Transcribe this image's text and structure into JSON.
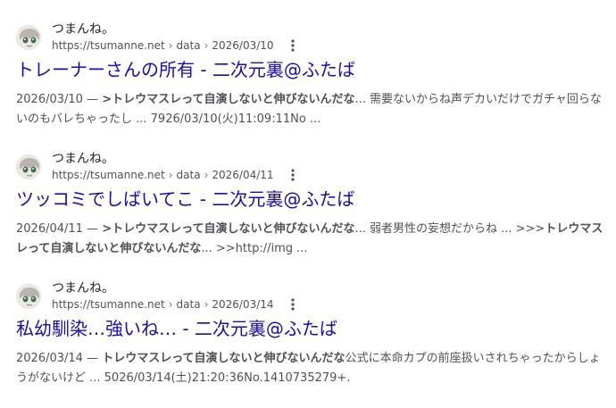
{
  "results": [
    {
      "site_name": "つまんね。",
      "url_base": "https://tsumanne.net",
      "url_crumbs": [
        "data",
        "2026/03/10"
      ],
      "title": "トレーナーさんの所有 - 二次元裏@ふたば",
      "snippet_parts": [
        {
          "text": "2026/03/10 — ",
          "bold": false
        },
        {
          "text": ">トレウマスレって自演しないと伸びないんだな",
          "bold": true
        },
        {
          "text": "... 需要ないからね声デカいだけでガチャ回らないのもバレちゃったし ... 7926/03/10(火)11:09:11No ...",
          "bold": false
        }
      ]
    },
    {
      "site_name": "つまんね。",
      "url_base": "https://tsumanne.net",
      "url_crumbs": [
        "data",
        "2026/04/11"
      ],
      "title": "ツッコミでしばいてこ - 二次元裏@ふたば",
      "snippet_parts": [
        {
          "text": "2026/04/11 — ",
          "bold": false
        },
        {
          "text": ">トレウマスレって自演しないと伸びないんだな",
          "bold": true
        },
        {
          "text": "... 弱者男性の妄想だからね ... >>>",
          "bold": false
        },
        {
          "text": "トレウマスレって自演しないと伸びないんだな",
          "bold": true
        },
        {
          "text": "... >>http://img ...",
          "bold": false
        }
      ]
    },
    {
      "site_name": "つまんね。",
      "url_base": "https://tsumanne.net",
      "url_crumbs": [
        "data",
        "2026/03/14"
      ],
      "title": "私幼馴染…強いね… - 二次元裏@ふたば",
      "snippet_parts": [
        {
          "text": "2026/03/14 — ",
          "bold": false
        },
        {
          "text": "トレウマスレって自演しないと伸びないんだな",
          "bold": true
        },
        {
          "text": "公式に本命カプの前座扱いされちゃったからしょうがないけど ... 5026/03/14(土)21:20:36No.1410735279+.",
          "bold": false
        }
      ]
    }
  ],
  "icons": {
    "favicon": "anime-avatar-icon",
    "more": "more-vert-icon"
  },
  "colors": {
    "title_link": "#1a0dab",
    "snippet_text": "#4d5156",
    "site_name": "#202124"
  }
}
